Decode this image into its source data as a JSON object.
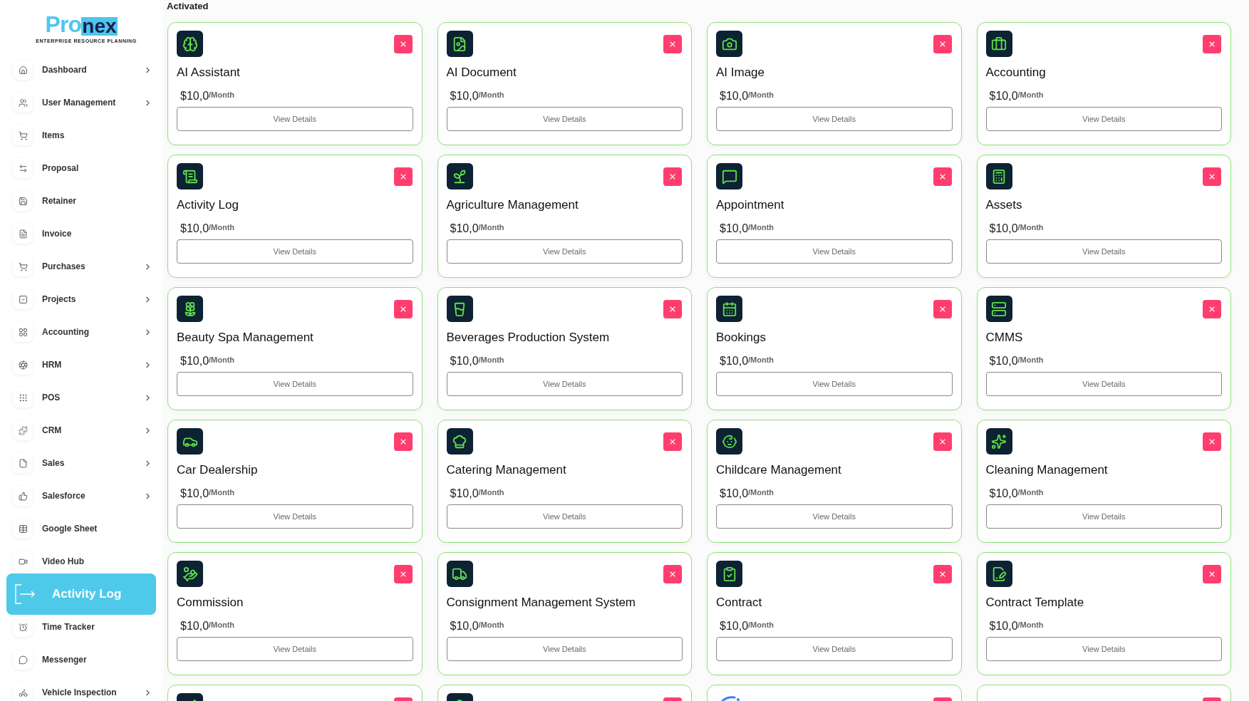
{
  "logo": {
    "name_start": "Pro",
    "name_end": "nex",
    "tagline": "ENTERPRISE RESOURCE PLANNING"
  },
  "sidebar": {
    "items": [
      {
        "label": "Dashboard",
        "has_submenu": true,
        "selected": false
      },
      {
        "label": "User Management",
        "has_submenu": true,
        "selected": false
      },
      {
        "label": "Items",
        "has_submenu": false,
        "selected": false
      },
      {
        "label": "Proposal",
        "has_submenu": false,
        "selected": false
      },
      {
        "label": "Retainer",
        "has_submenu": false,
        "selected": false
      },
      {
        "label": "Invoice",
        "has_submenu": false,
        "selected": false
      },
      {
        "label": "Purchases",
        "has_submenu": true,
        "selected": false
      },
      {
        "label": "Projects",
        "has_submenu": true,
        "selected": false
      },
      {
        "label": "Accounting",
        "has_submenu": true,
        "selected": false
      },
      {
        "label": "HRM",
        "has_submenu": true,
        "selected": false
      },
      {
        "label": "POS",
        "has_submenu": true,
        "selected": false
      },
      {
        "label": "CRM",
        "has_submenu": true,
        "selected": false
      },
      {
        "label": "Sales",
        "has_submenu": true,
        "selected": false
      },
      {
        "label": "Salesforce",
        "has_submenu": true,
        "selected": false
      },
      {
        "label": "Google Sheet",
        "has_submenu": false,
        "selected": false
      },
      {
        "label": "Video Hub",
        "has_submenu": false,
        "selected": false
      },
      {
        "label": "Activity Log",
        "has_submenu": false,
        "selected": true
      },
      {
        "label": "Time Tracker",
        "has_submenu": false,
        "selected": false
      },
      {
        "label": "Messenger",
        "has_submenu": false,
        "selected": false
      },
      {
        "label": "Vehicle Inspection",
        "has_submenu": true,
        "selected": false
      }
    ]
  },
  "section_title": "Activated",
  "cards": [
    {
      "name": "AI Assistant",
      "price": "$10,0",
      "period": "/Month",
      "button": "View Details"
    },
    {
      "name": "AI Document",
      "price": "$10,0",
      "period": "/Month",
      "button": "View Details"
    },
    {
      "name": "AI Image",
      "price": "$10,0",
      "period": "/Month",
      "button": "View Details"
    },
    {
      "name": "Accounting",
      "price": "$10,0",
      "period": "/Month",
      "button": "View Details"
    },
    {
      "name": "Activity Log",
      "price": "$10,0",
      "period": "/Month",
      "button": "View Details"
    },
    {
      "name": "Agriculture Management",
      "price": "$10,0",
      "period": "/Month",
      "button": "View Details"
    },
    {
      "name": "Appointment",
      "price": "$10,0",
      "period": "/Month",
      "button": "View Details"
    },
    {
      "name": "Assets",
      "price": "$10,0",
      "period": "/Month",
      "button": "View Details"
    },
    {
      "name": "Beauty Spa Management",
      "price": "$10,0",
      "period": "/Month",
      "button": "View Details"
    },
    {
      "name": "Beverages Production System",
      "price": "$10,0",
      "period": "/Month",
      "button": "View Details"
    },
    {
      "name": "Bookings",
      "price": "$10,0",
      "period": "/Month",
      "button": "View Details"
    },
    {
      "name": "CMMS",
      "price": "$10,0",
      "period": "/Month",
      "button": "View Details"
    },
    {
      "name": "Car Dealership",
      "price": "$10,0",
      "period": "/Month",
      "button": "View Details"
    },
    {
      "name": "Catering Management",
      "price": "$10,0",
      "period": "/Month",
      "button": "View Details"
    },
    {
      "name": "Childcare Management",
      "price": "$10,0",
      "period": "/Month",
      "button": "View Details"
    },
    {
      "name": "Cleaning Management",
      "price": "$10,0",
      "period": "/Month",
      "button": "View Details"
    },
    {
      "name": "Commission",
      "price": "$10,0",
      "period": "/Month",
      "button": "View Details"
    },
    {
      "name": "Consignment Management System",
      "price": "$10,0",
      "period": "/Month",
      "button": "View Details"
    },
    {
      "name": "Contract",
      "price": "$10,0",
      "period": "/Month",
      "button": "View Details"
    },
    {
      "name": "Contract Template",
      "price": "$10,0",
      "period": "/Month",
      "button": "View Details"
    }
  ],
  "partial_cards": [
    {
      "kind": "icon"
    },
    {
      "kind": "icon"
    },
    {
      "kind": "loading"
    },
    {
      "kind": "blank"
    }
  ]
}
